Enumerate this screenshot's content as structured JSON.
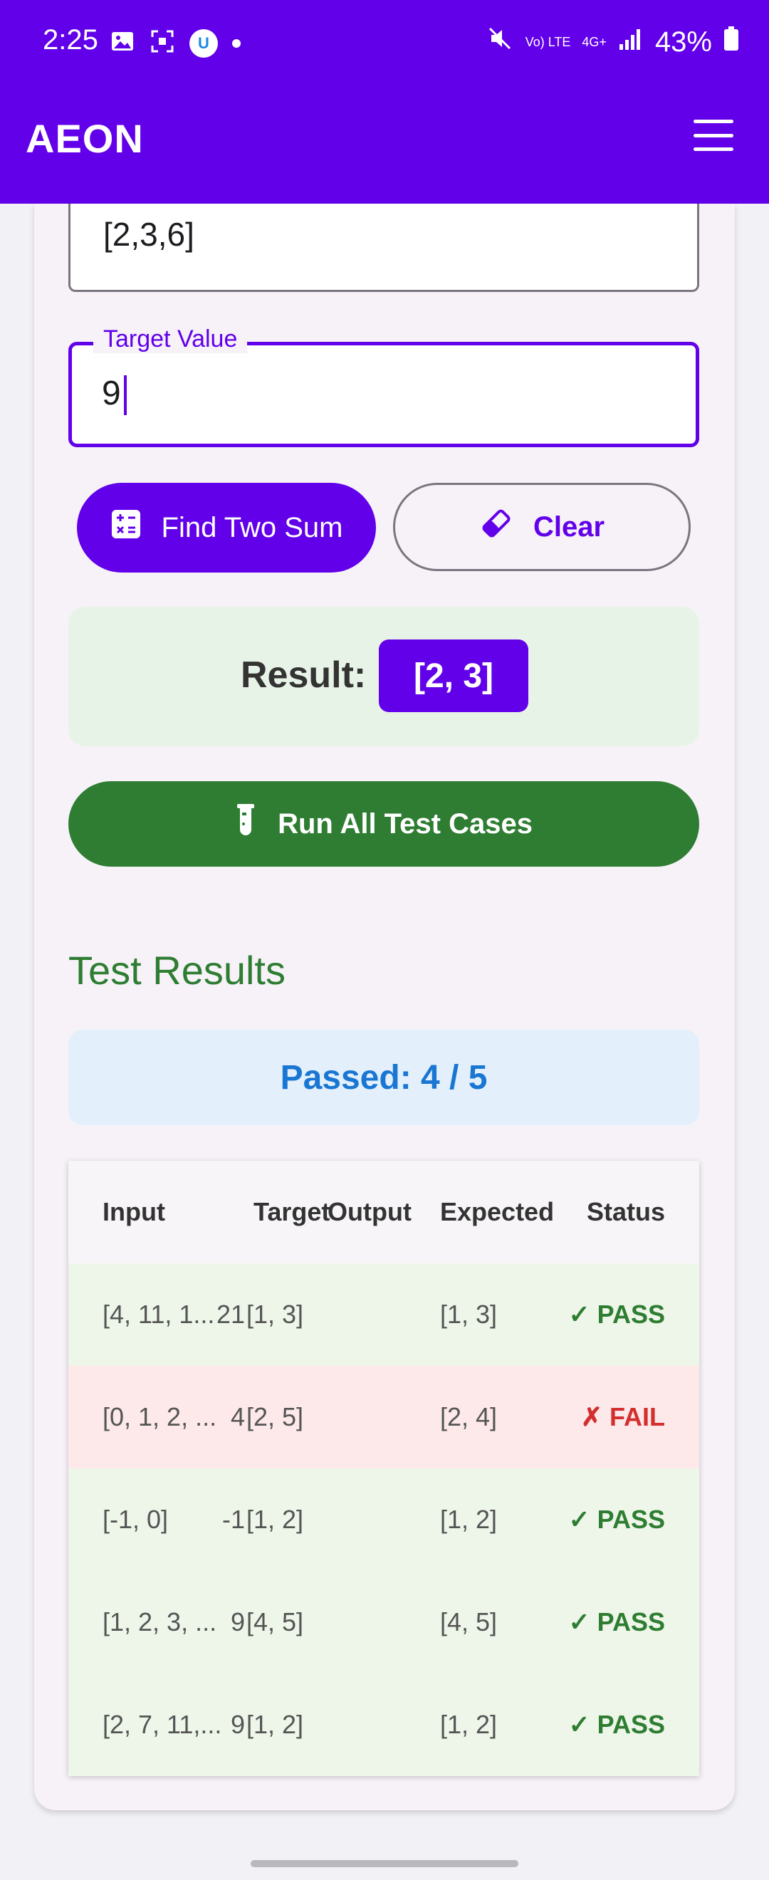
{
  "status_bar": {
    "time": "2:25",
    "battery": "43%",
    "volte": "Vo) LTE",
    "net": "4G+",
    "icons_left": [
      "image-icon",
      "screenshot-icon",
      "app-badge-icon",
      "dot-icon"
    ],
    "icons_right": [
      "mute-icon",
      "volte-icon",
      "network-icon",
      "signal-icon",
      "battery-icon"
    ]
  },
  "app_bar": {
    "title": "AEON"
  },
  "array_field": {
    "value": "[2,3,6]"
  },
  "target_field": {
    "label": "Target Value",
    "value": "9"
  },
  "buttons": {
    "find": "Find Two Sum",
    "clear": "Clear",
    "run": "Run All Test Cases"
  },
  "result": {
    "label": "Result:",
    "value": "[2, 3]"
  },
  "test_results": {
    "title": "Test Results",
    "passed": "Passed: 4 / 5",
    "headers": {
      "input": "Input",
      "target": "Target",
      "output": "Output",
      "expected": "Expected",
      "status": "Status"
    },
    "rows": [
      {
        "input": "[4, 11, 1...",
        "target": "21",
        "output": "[1, 3]",
        "expected": "[1, 3]",
        "status": "✓ PASS",
        "result": "pass"
      },
      {
        "input": "[0, 1, 2, ...",
        "target": "4",
        "output": "[2, 5]",
        "expected": "[2, 4]",
        "status": "✗ FAIL",
        "result": "fail"
      },
      {
        "input": "[-1, 0]",
        "target": "-1",
        "output": "[1, 2]",
        "expected": "[1, 2]",
        "status": "✓ PASS",
        "result": "pass"
      },
      {
        "input": "[1, 2, 3, ...",
        "target": "9",
        "output": "[4, 5]",
        "expected": "[4, 5]",
        "status": "✓ PASS",
        "result": "pass"
      },
      {
        "input": "[2, 7, 11,...",
        "target": "9",
        "output": "[1, 2]",
        "expected": "[1, 2]",
        "status": "✓ PASS",
        "result": "pass"
      }
    ]
  },
  "colors": {
    "primary": "#6200ea",
    "success": "#2e7d32",
    "fail": "#d32f2f",
    "info": "#1976d2"
  }
}
